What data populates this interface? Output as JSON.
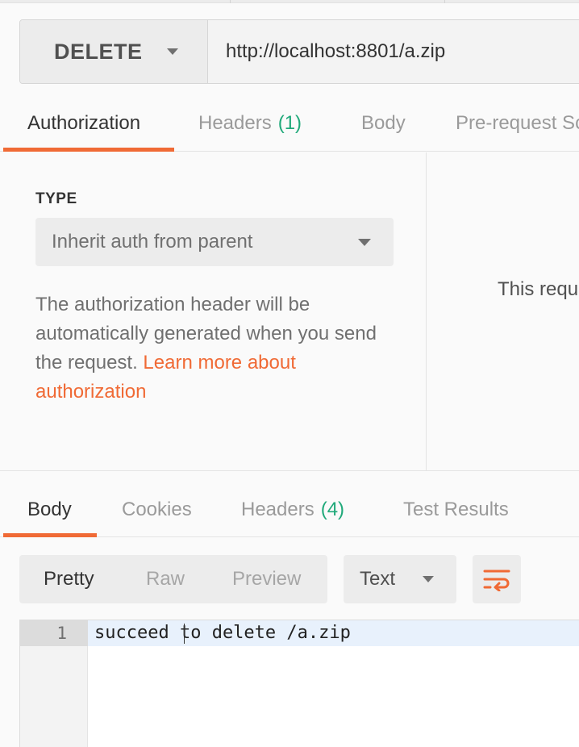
{
  "request": {
    "method": "DELETE",
    "url": "http://localhost:8801/a.zip"
  },
  "request_tabs": [
    {
      "label": "Authorization",
      "count": "",
      "active": true
    },
    {
      "label": "Headers",
      "count": "(1)",
      "active": false
    },
    {
      "label": "Body",
      "count": "",
      "active": false
    },
    {
      "label": "Pre-request Sc",
      "count": "",
      "active": false
    }
  ],
  "auth": {
    "type_label": "TYPE",
    "type_value": "Inherit auth from parent",
    "description": "The authorization header will be automatically generated when you send the request.",
    "link_text": "Learn more about authorization",
    "right_panel_text": "This requ"
  },
  "response_tabs": [
    {
      "label": "Body",
      "count": "",
      "active": true
    },
    {
      "label": "Cookies",
      "count": "",
      "active": false
    },
    {
      "label": "Headers",
      "count": "(4)",
      "active": false
    },
    {
      "label": "Test Results",
      "count": "",
      "active": false
    }
  ],
  "response_view": {
    "options": [
      "Pretty",
      "Raw",
      "Preview"
    ],
    "selected": "Pretty",
    "format": "Text",
    "wrap_icon": "wrap-lines-icon"
  },
  "code": {
    "lines": [
      {
        "number": "1",
        "text": "succeed to delete /a.zip"
      }
    ]
  },
  "colors": {
    "accent": "#f06a35",
    "count": "#20a97a"
  }
}
